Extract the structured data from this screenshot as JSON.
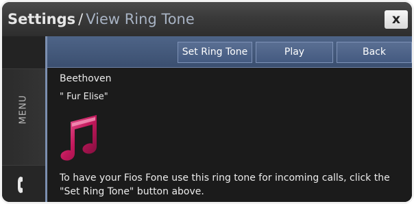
{
  "header": {
    "root": "Settings",
    "separator": "/",
    "page": "View Ring Tone",
    "close_label": "x"
  },
  "sidebar": {
    "menu_label": "MENU",
    "phone_icon": "phone-handset-icon"
  },
  "toolbar": {
    "buttons": [
      {
        "label": "Set Ring Tone"
      },
      {
        "label": "Play"
      },
      {
        "label": "Back"
      }
    ]
  },
  "ringtone": {
    "artist": "Beethoven",
    "title": "\" Fur Elise\"",
    "icon": "music-note-icon",
    "instructions": "To have your Fios Fone use this ring tone for incoming calls, click the \"Set Ring Tone\" button above."
  },
  "colors": {
    "toolbar": "#445a80",
    "accent_pink": "#c2185b",
    "title_page": "#a8b3c4"
  }
}
